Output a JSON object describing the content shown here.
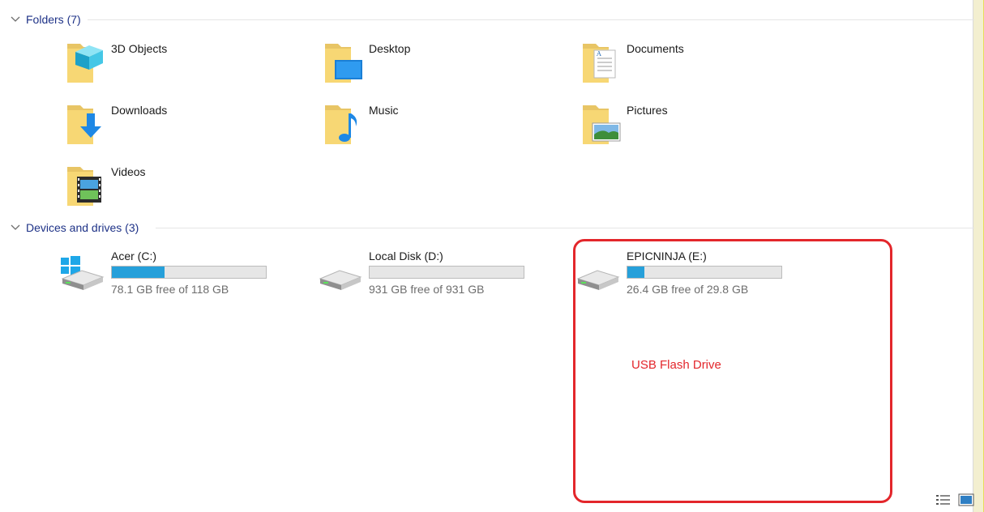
{
  "sections": {
    "folders": {
      "title": "Folders (7)"
    },
    "devices": {
      "title": "Devices and drives (3)"
    }
  },
  "folders": [
    {
      "label": "3D Objects",
      "icon": "3d-objects-folder-icon"
    },
    {
      "label": "Desktop",
      "icon": "desktop-folder-icon"
    },
    {
      "label": "Documents",
      "icon": "documents-folder-icon"
    },
    {
      "label": "Downloads",
      "icon": "downloads-folder-icon"
    },
    {
      "label": "Music",
      "icon": "music-folder-icon"
    },
    {
      "label": "Pictures",
      "icon": "pictures-folder-icon"
    },
    {
      "label": "Videos",
      "icon": "videos-folder-icon"
    }
  ],
  "drives": [
    {
      "label": "Acer (C:)",
      "free_text": "78.1 GB free of 118 GB",
      "used_fraction": 0.34
    },
    {
      "label": "Local Disk (D:)",
      "free_text": "931 GB free of 931 GB",
      "used_fraction": 0.0
    },
    {
      "label": "EPICNINJA (E:)",
      "free_text": "26.4 GB free of 29.8 GB",
      "used_fraction": 0.11
    }
  ],
  "annotation": {
    "text": "USB Flash Drive",
    "color": "#e3262b"
  },
  "colors": {
    "header": "#1e3287",
    "bar_fill": "#26a0da",
    "bar_bg": "#e6e6e6"
  },
  "view_buttons": [
    {
      "icon": "details-view-icon"
    },
    {
      "icon": "large-icons-view-icon"
    }
  ]
}
